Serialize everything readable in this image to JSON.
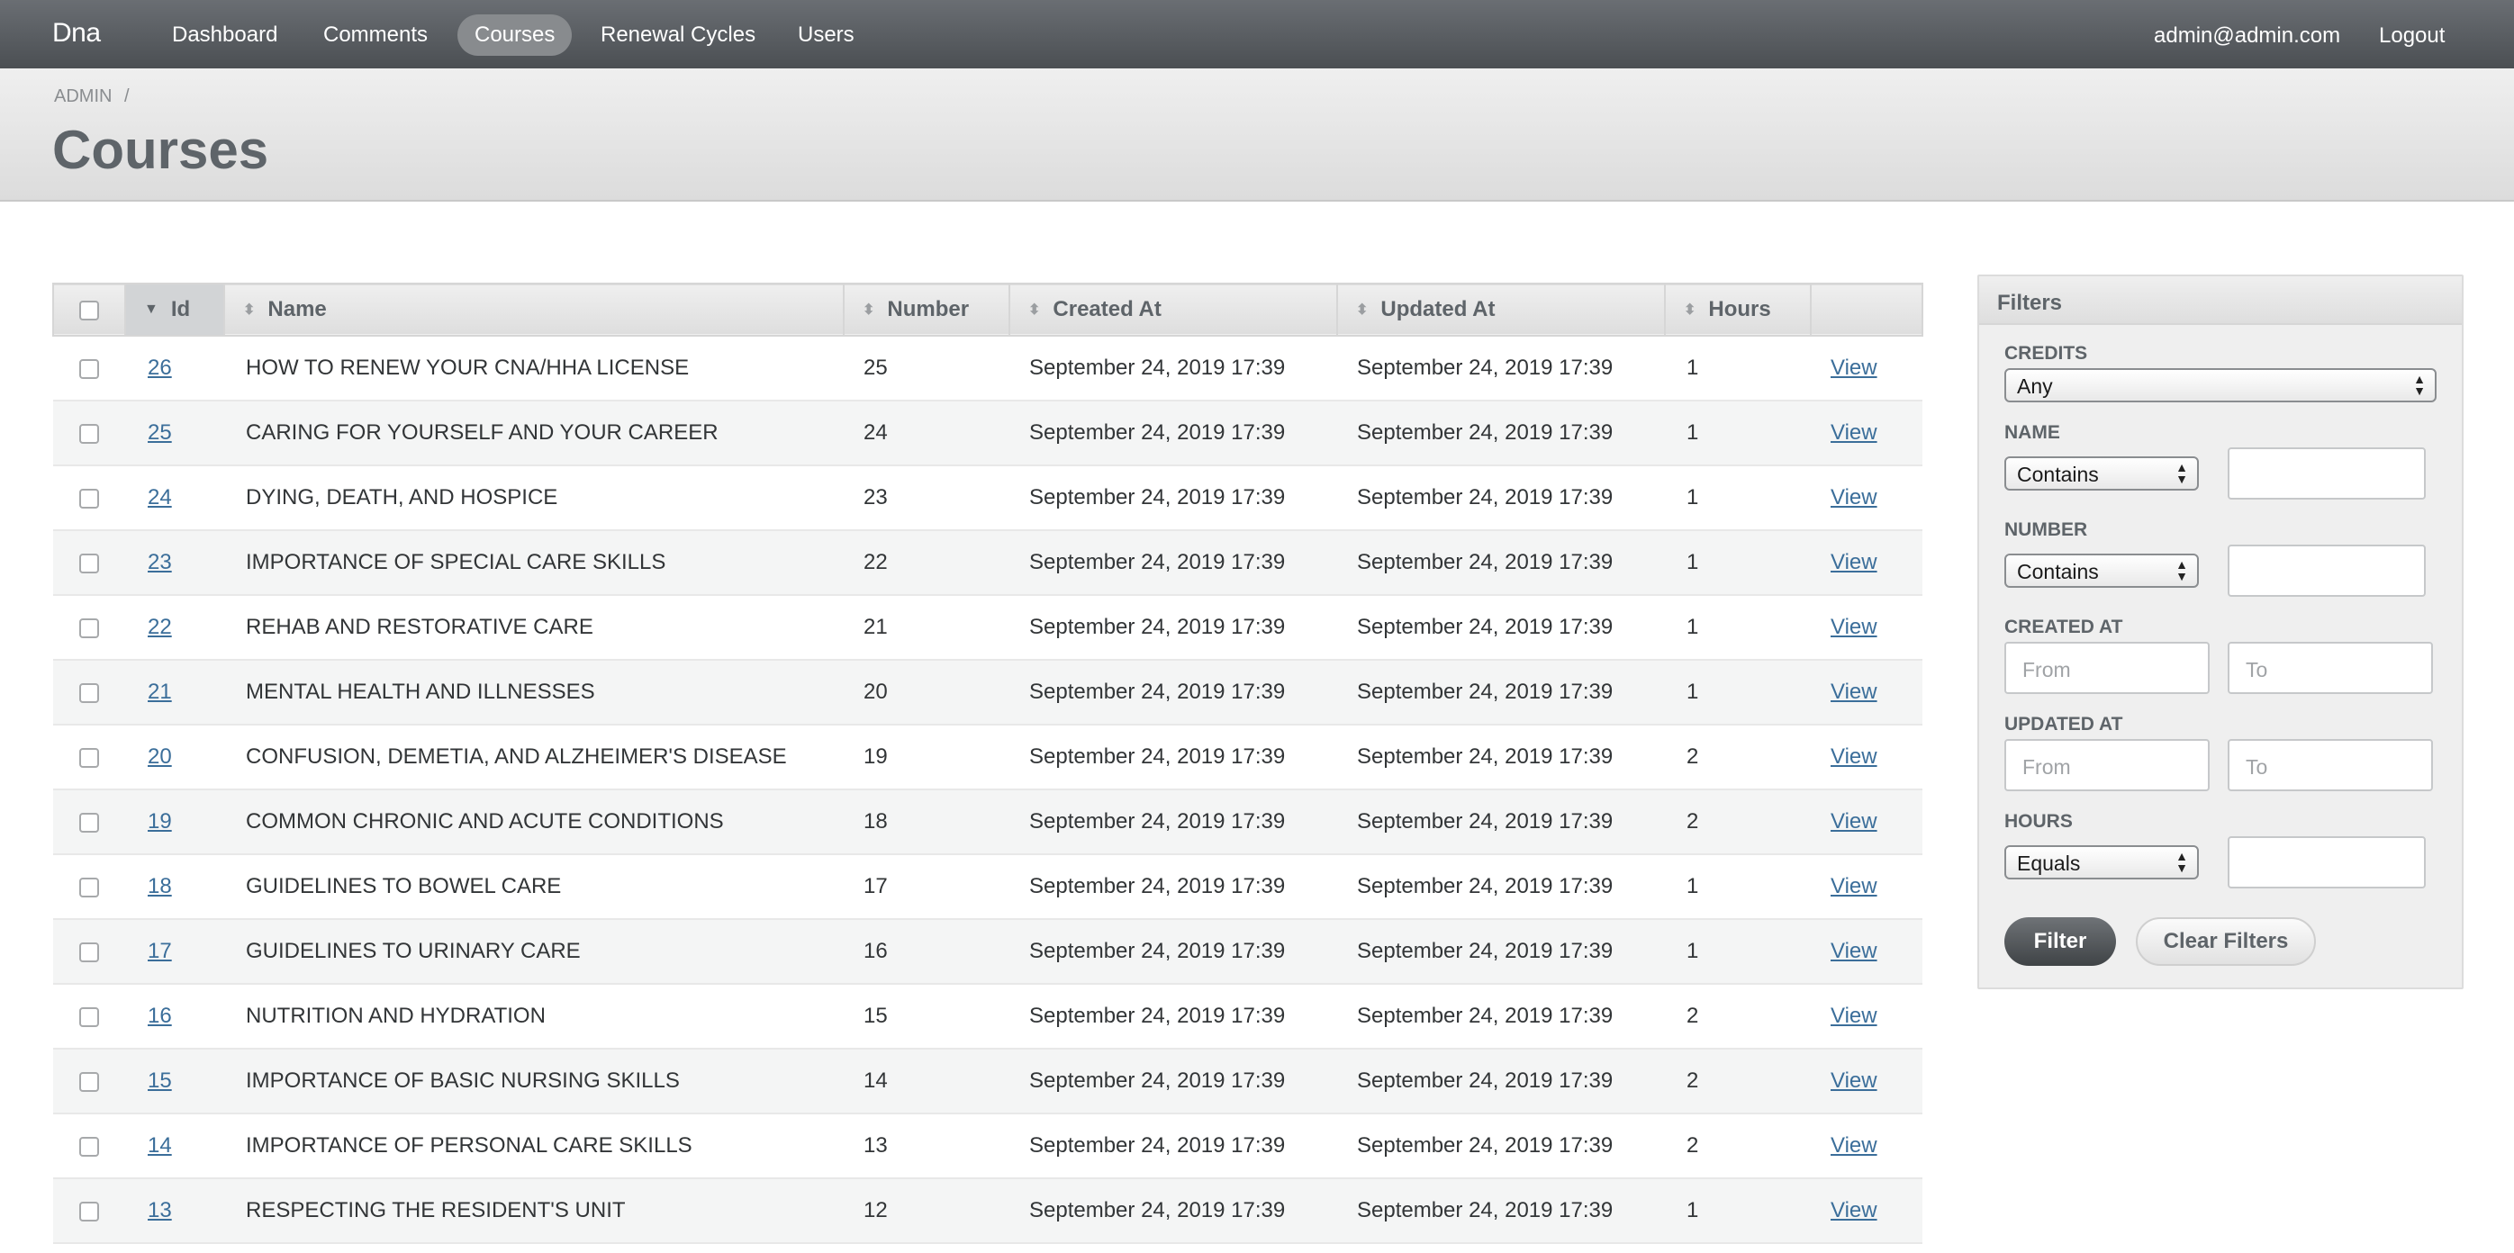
{
  "header": {
    "site_title": "Dna",
    "tabs": [
      {
        "label": "Dashboard"
      },
      {
        "label": "Comments"
      },
      {
        "label": "Courses"
      },
      {
        "label": "Renewal Cycles"
      },
      {
        "label": "Users"
      }
    ],
    "current_user": "admin@admin.com",
    "logout": "Logout"
  },
  "title_bar": {
    "breadcrumb": "ADMIN",
    "breadcrumb_sep": "/",
    "page_title": "Courses"
  },
  "table": {
    "columns": {
      "id": "Id",
      "name": "Name",
      "number": "Number",
      "created_at": "Created At",
      "updated_at": "Updated At",
      "hours": "Hours"
    },
    "rows": [
      {
        "id": "26",
        "name": "HOW TO RENEW YOUR CNA/HHA LICENSE",
        "number": "25",
        "created_at": "September 24, 2019 17:39",
        "updated_at": "September 24, 2019 17:39",
        "hours": "1",
        "view": "View"
      },
      {
        "id": "25",
        "name": "CARING FOR YOURSELF AND YOUR CAREER",
        "number": "24",
        "created_at": "September 24, 2019 17:39",
        "updated_at": "September 24, 2019 17:39",
        "hours": "1",
        "view": "View"
      },
      {
        "id": "24",
        "name": "DYING, DEATH, AND HOSPICE",
        "number": "23",
        "created_at": "September 24, 2019 17:39",
        "updated_at": "September 24, 2019 17:39",
        "hours": "1",
        "view": "View"
      },
      {
        "id": "23",
        "name": "IMPORTANCE OF SPECIAL CARE SKILLS",
        "number": "22",
        "created_at": "September 24, 2019 17:39",
        "updated_at": "September 24, 2019 17:39",
        "hours": "1",
        "view": "View"
      },
      {
        "id": "22",
        "name": "REHAB AND RESTORATIVE CARE",
        "number": "21",
        "created_at": "September 24, 2019 17:39",
        "updated_at": "September 24, 2019 17:39",
        "hours": "1",
        "view": "View"
      },
      {
        "id": "21",
        "name": "MENTAL HEALTH AND ILLNESSES",
        "number": "20",
        "created_at": "September 24, 2019 17:39",
        "updated_at": "September 24, 2019 17:39",
        "hours": "1",
        "view": "View"
      },
      {
        "id": "20",
        "name": "CONFUSION, DEMETIA, AND ALZHEIMER'S DISEASE",
        "number": "19",
        "created_at": "September 24, 2019 17:39",
        "updated_at": "September 24, 2019 17:39",
        "hours": "2",
        "view": "View"
      },
      {
        "id": "19",
        "name": "COMMON CHRONIC AND ACUTE CONDITIONS",
        "number": "18",
        "created_at": "September 24, 2019 17:39",
        "updated_at": "September 24, 2019 17:39",
        "hours": "2",
        "view": "View"
      },
      {
        "id": "18",
        "name": "GUIDELINES TO BOWEL CARE",
        "number": "17",
        "created_at": "September 24, 2019 17:39",
        "updated_at": "September 24, 2019 17:39",
        "hours": "1",
        "view": "View"
      },
      {
        "id": "17",
        "name": "GUIDELINES TO URINARY CARE",
        "number": "16",
        "created_at": "September 24, 2019 17:39",
        "updated_at": "September 24, 2019 17:39",
        "hours": "1",
        "view": "View"
      },
      {
        "id": "16",
        "name": "NUTRITION AND HYDRATION",
        "number": "15",
        "created_at": "September 24, 2019 17:39",
        "updated_at": "September 24, 2019 17:39",
        "hours": "2",
        "view": "View"
      },
      {
        "id": "15",
        "name": "IMPORTANCE OF BASIC NURSING SKILLS",
        "number": "14",
        "created_at": "September 24, 2019 17:39",
        "updated_at": "September 24, 2019 17:39",
        "hours": "2",
        "view": "View"
      },
      {
        "id": "14",
        "name": "IMPORTANCE OF PERSONAL CARE SKILLS",
        "number": "13",
        "created_at": "September 24, 2019 17:39",
        "updated_at": "September 24, 2019 17:39",
        "hours": "2",
        "view": "View"
      },
      {
        "id": "13",
        "name": "RESPECTING THE RESIDENT'S UNIT",
        "number": "12",
        "created_at": "September 24, 2019 17:39",
        "updated_at": "September 24, 2019 17:39",
        "hours": "1",
        "view": "View"
      }
    ]
  },
  "filters": {
    "title": "Filters",
    "credits_label": "CREDITS",
    "credits_value": "Any",
    "name_label": "NAME",
    "name_operator": "Contains",
    "number_label": "NUMBER",
    "number_operator": "Contains",
    "created_label": "CREATED AT",
    "updated_label": "UPDATED AT",
    "from_placeholder": "From",
    "to_placeholder": "To",
    "hours_label": "HOURS",
    "hours_operator": "Equals",
    "filter_button": "Filter",
    "clear_button": "Clear Filters"
  }
}
